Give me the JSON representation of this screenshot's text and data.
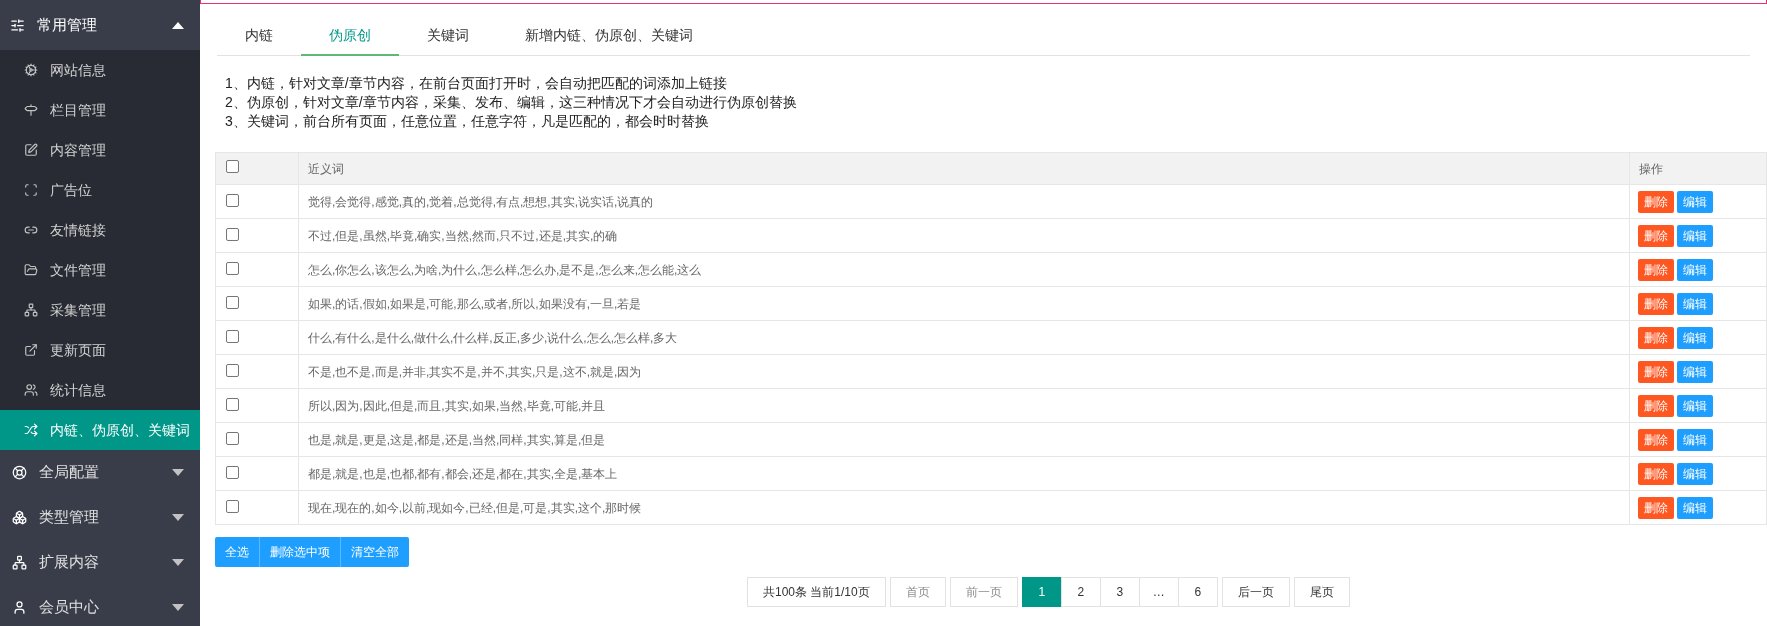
{
  "sidebar": {
    "groups": [
      {
        "label": "常用管理",
        "expanded": true,
        "items": [
          {
            "label": "网站信息",
            "selected": false
          },
          {
            "label": "栏目管理",
            "selected": false
          },
          {
            "label": "内容管理",
            "selected": false
          },
          {
            "label": "广告位",
            "selected": false
          },
          {
            "label": "友情链接",
            "selected": false
          },
          {
            "label": "文件管理",
            "selected": false
          },
          {
            "label": "采集管理",
            "selected": false
          },
          {
            "label": "更新页面",
            "selected": false
          },
          {
            "label": "统计信息",
            "selected": false
          },
          {
            "label": "内链、伪原创、关键词",
            "selected": true
          }
        ]
      },
      {
        "label": "全局配置",
        "expanded": false
      },
      {
        "label": "类型管理",
        "expanded": false
      },
      {
        "label": "扩展内容",
        "expanded": false
      },
      {
        "label": "会员中心",
        "expanded": false
      }
    ]
  },
  "tabs": [
    {
      "label": "内链",
      "selected": false
    },
    {
      "label": "伪原创",
      "selected": true
    },
    {
      "label": "关键词",
      "selected": false
    },
    {
      "label": "新增内链、伪原创、关键词",
      "selected": false
    }
  ],
  "notes": [
    "1、内链，针对文章/章节内容，在前台页面打开时，会自动把匹配的词添加上链接",
    "2、伪原创，针对文章/章节内容，采集、发布、编辑，这三种情况下才会自动进行伪原创替换",
    "3、关键词，前台所有页面，任意位置，任意字符，凡是匹配的，都会时时替换"
  ],
  "table": {
    "header_checked": false,
    "columns": [
      "近义词",
      "操作"
    ],
    "rows": [
      {
        "checked": false,
        "synonyms": "觉得,会觉得,感觉,真的,觉着,总觉得,有点,想想,其实,说实话,说真的",
        "actions": [
          "删除",
          "编辑"
        ]
      },
      {
        "checked": false,
        "synonyms": "不过,但是,虽然,毕竟,确实,当然,然而,只不过,还是,其实,的确",
        "actions": [
          "删除",
          "编辑"
        ]
      },
      {
        "checked": false,
        "synonyms": "怎么,你怎么,该怎么,为啥,为什么,怎么样,怎么办,是不是,怎么来,怎么能,这么",
        "actions": [
          "删除",
          "编辑"
        ]
      },
      {
        "checked": false,
        "synonyms": "如果,的话,假如,如果是,可能,那么,或者,所以,如果没有,一旦,若是",
        "actions": [
          "删除",
          "编辑"
        ]
      },
      {
        "checked": false,
        "synonyms": "什么,有什么,是什么,做什么,什么样,反正,多少,说什么,怎么,怎么样,多大",
        "actions": [
          "删除",
          "编辑"
        ]
      },
      {
        "checked": false,
        "synonyms": "不是,也不是,而是,并非,其实不是,并不,其实,只是,这不,就是,因为",
        "actions": [
          "删除",
          "编辑"
        ]
      },
      {
        "checked": false,
        "synonyms": "所以,因为,因此,但是,而且,其实,如果,当然,毕竟,可能,并且",
        "actions": [
          "删除",
          "编辑"
        ]
      },
      {
        "checked": false,
        "synonyms": "也是,就是,更是,这是,都是,还是,当然,同样,其实,算是,但是",
        "actions": [
          "删除",
          "编辑"
        ]
      },
      {
        "checked": false,
        "synonyms": "都是,就是,也是,也都,都有,都会,还是,都在,其实,全是,基本上",
        "actions": [
          "删除",
          "编辑"
        ]
      },
      {
        "checked": false,
        "synonyms": "现在,现在的,如今,以前,现如今,已经,但是,可是,其实,这个,那时候",
        "actions": [
          "删除",
          "编辑"
        ]
      }
    ]
  },
  "bulk_actions": [
    "全选",
    "删除选中项",
    "清空全部"
  ],
  "pagination": {
    "summary": "共100条 当前1/10页",
    "items": [
      {
        "label": "首页",
        "kind": "nav",
        "disabled": true
      },
      {
        "label": "前一页",
        "kind": "nav",
        "disabled": true
      },
      {
        "label": "1",
        "kind": "page",
        "selected": true
      },
      {
        "label": "2",
        "kind": "page",
        "selected": false
      },
      {
        "label": "3",
        "kind": "page",
        "selected": false
      },
      {
        "label": "…",
        "kind": "gap"
      },
      {
        "label": "6",
        "kind": "page",
        "selected": false
      },
      {
        "label": "后一页",
        "kind": "nav",
        "disabled": false
      },
      {
        "label": "尾页",
        "kind": "nav",
        "disabled": false
      }
    ]
  }
}
